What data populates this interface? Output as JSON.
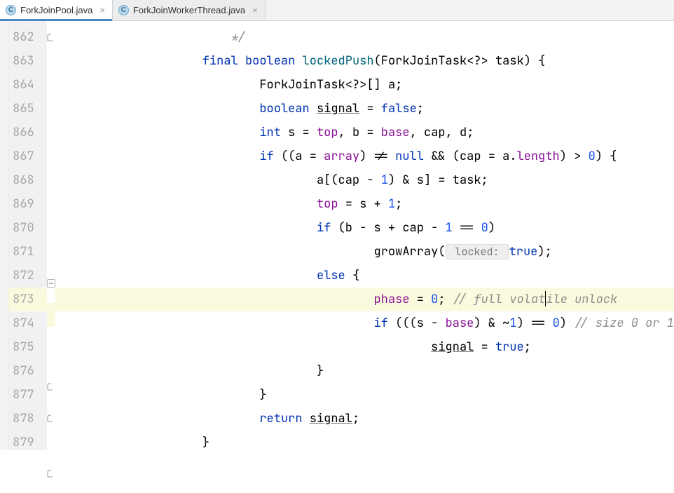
{
  "tabs": [
    {
      "icon_letter": "C",
      "label": "ForkJoinPool.java",
      "active": true
    },
    {
      "icon_letter": "C",
      "label": "ForkJoinWorkerThread.java",
      "active": false
    }
  ],
  "gutter": {
    "start": 862,
    "count": 18
  },
  "highlighted_line": 873,
  "cursor": {
    "line": 873,
    "after_token_index": 19
  },
  "fold_markers": {
    "862": "close",
    "872": "open",
    "876": "close",
    "877": "close",
    "879": "close"
  },
  "code_lines": [
    {
      "n": 862,
      "indent": 6,
      "tokens": [
        {
          "t": "*/",
          "c": "cmt"
        }
      ]
    },
    {
      "n": 863,
      "indent": 5,
      "tokens": [
        {
          "t": "final ",
          "c": "kw"
        },
        {
          "t": "boolean ",
          "c": "kw"
        },
        {
          "t": "lockedPush",
          "c": "mtd"
        },
        {
          "t": "(ForkJoinTask<?> task) {",
          "c": ""
        }
      ]
    },
    {
      "n": 864,
      "indent": 7,
      "tokens": [
        {
          "t": "ForkJoinTask<?>[] a;",
          "c": ""
        }
      ]
    },
    {
      "n": 865,
      "indent": 7,
      "tokens": [
        {
          "t": "boolean ",
          "c": "kw"
        },
        {
          "t": "signal",
          "c": "ul"
        },
        {
          "t": " = ",
          "c": ""
        },
        {
          "t": "false",
          "c": "kw"
        },
        {
          "t": ";",
          "c": ""
        }
      ]
    },
    {
      "n": 866,
      "indent": 7,
      "tokens": [
        {
          "t": "int ",
          "c": "kw"
        },
        {
          "t": "s = ",
          "c": ""
        },
        {
          "t": "top",
          "c": "id"
        },
        {
          "t": ", b = ",
          "c": ""
        },
        {
          "t": "base",
          "c": "id"
        },
        {
          "t": ", cap, d;",
          "c": ""
        }
      ]
    },
    {
      "n": 867,
      "indent": 7,
      "tokens": [
        {
          "t": "if ",
          "c": "kw"
        },
        {
          "t": "((a = ",
          "c": ""
        },
        {
          "t": "array",
          "c": "id"
        },
        {
          "t": ") != ",
          "c": ""
        },
        {
          "t": "null ",
          "c": "kw"
        },
        {
          "t": "&& (cap = a.",
          "c": ""
        },
        {
          "t": "length",
          "c": "id"
        },
        {
          "t": ") > ",
          "c": ""
        },
        {
          "t": "0",
          "c": "num"
        },
        {
          "t": ") {",
          "c": ""
        }
      ]
    },
    {
      "n": 868,
      "indent": 9,
      "tokens": [
        {
          "t": "a[(cap - ",
          "c": ""
        },
        {
          "t": "1",
          "c": "num"
        },
        {
          "t": ") & s] = task;",
          "c": ""
        }
      ]
    },
    {
      "n": 869,
      "indent": 9,
      "tokens": [
        {
          "t": "top",
          "c": "id"
        },
        {
          "t": " = s + ",
          "c": ""
        },
        {
          "t": "1",
          "c": "num"
        },
        {
          "t": ";",
          "c": ""
        }
      ]
    },
    {
      "n": 870,
      "indent": 9,
      "tokens": [
        {
          "t": "if ",
          "c": "kw"
        },
        {
          "t": "(b - s + cap - ",
          "c": ""
        },
        {
          "t": "1 ",
          "c": "num"
        },
        {
          "t": "== ",
          "c": ""
        },
        {
          "t": "0",
          "c": "num"
        },
        {
          "t": ")",
          "c": ""
        }
      ]
    },
    {
      "n": 871,
      "indent": 11,
      "tokens": [
        {
          "t": "growArray(",
          "c": ""
        },
        {
          "t": " locked: ",
          "c": "hint"
        },
        {
          "t": "true",
          "c": "kw"
        },
        {
          "t": ");",
          "c": ""
        }
      ]
    },
    {
      "n": 872,
      "indent": 9,
      "tokens": [
        {
          "t": "else ",
          "c": "kw"
        },
        {
          "t": "{",
          "c": ""
        }
      ]
    },
    {
      "n": 873,
      "indent": 11,
      "tokens": [
        {
          "t": "phase",
          "c": "id"
        },
        {
          "t": " = ",
          "c": ""
        },
        {
          "t": "0",
          "c": "num"
        },
        {
          "t": "; ",
          "c": ""
        },
        {
          "t": "// full volat",
          "c": "cmt"
        },
        {
          "t": "",
          "cursor": true
        },
        {
          "t": "ile unlock",
          "c": "cmt"
        }
      ]
    },
    {
      "n": 874,
      "indent": 11,
      "tokens": [
        {
          "t": "if ",
          "c": "kw"
        },
        {
          "t": "(((s - ",
          "c": ""
        },
        {
          "t": "base",
          "c": "id"
        },
        {
          "t": ") & ~",
          "c": ""
        },
        {
          "t": "1",
          "c": "num"
        },
        {
          "t": ") == ",
          "c": ""
        },
        {
          "t": "0",
          "c": "num"
        },
        {
          "t": ") ",
          "c": ""
        },
        {
          "t": "// size 0 or 1",
          "c": "cmt"
        }
      ]
    },
    {
      "n": 875,
      "indent": 13,
      "tokens": [
        {
          "t": "signal",
          "c": "ul"
        },
        {
          "t": " = ",
          "c": ""
        },
        {
          "t": "true",
          "c": "kw"
        },
        {
          "t": ";",
          "c": ""
        }
      ]
    },
    {
      "n": 876,
      "indent": 9,
      "tokens": [
        {
          "t": "}",
          "c": ""
        }
      ]
    },
    {
      "n": 877,
      "indent": 7,
      "tokens": [
        {
          "t": "}",
          "c": ""
        }
      ]
    },
    {
      "n": 878,
      "indent": 7,
      "tokens": [
        {
          "t": "return ",
          "c": "kw"
        },
        {
          "t": "signal",
          "c": "ul"
        },
        {
          "t": ";",
          "c": ""
        }
      ]
    },
    {
      "n": 879,
      "indent": 5,
      "tokens": [
        {
          "t": "}",
          "c": ""
        }
      ]
    }
  ]
}
